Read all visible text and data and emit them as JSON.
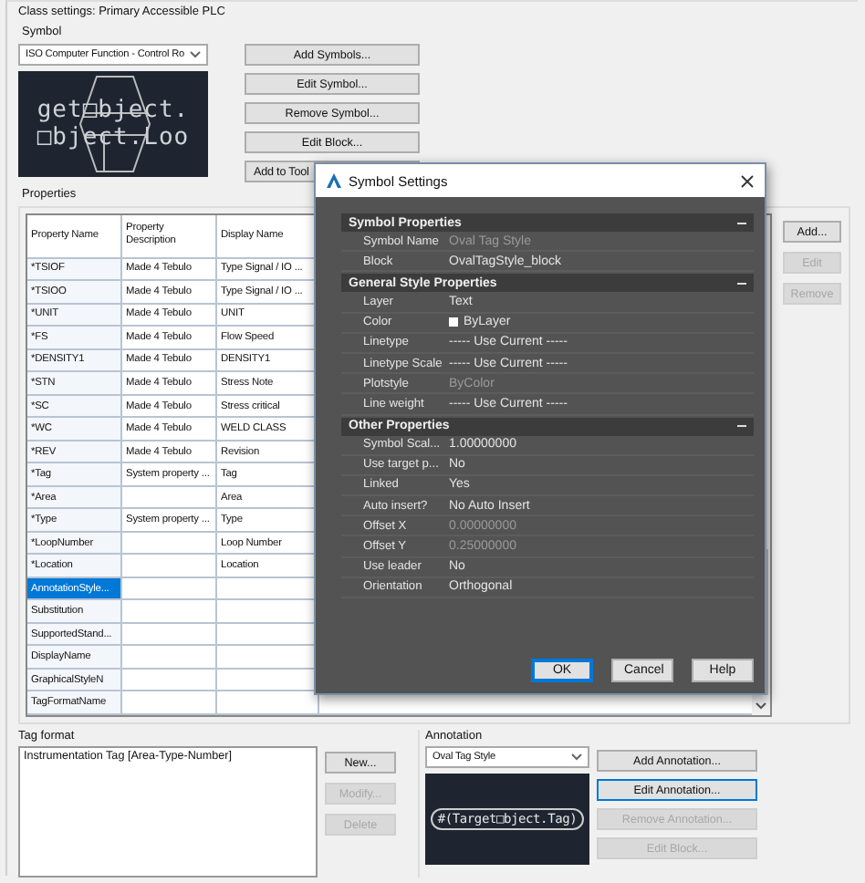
{
  "class_settings": {
    "title": "Class settings: Primary Accessible PLC"
  },
  "symbol": {
    "label": "Symbol",
    "dropdown": "ISO Computer Function - Control Ro",
    "preview_lines": [
      "get□bject.",
      "□bject.Loo"
    ],
    "buttons": [
      {
        "label": "Add Symbols...",
        "disabled": false
      },
      {
        "label": "Edit Symbol...",
        "disabled": false
      },
      {
        "label": "Remove Symbol...",
        "disabled": false
      },
      {
        "label": "Edit Block...",
        "disabled": false
      },
      {
        "label": "Add to Tool",
        "disabled": false
      }
    ]
  },
  "properties": {
    "label": "Properties",
    "columns": [
      "Property Name",
      "Property Description",
      "Display Name"
    ],
    "rows": [
      {
        "name": "*TSIOF",
        "description": "Made 4 Tebulo",
        "display": "Type Signal / IO ...",
        "selected": false
      },
      {
        "name": "*TSIOO",
        "description": "Made 4 Tebulo",
        "display": "Type Signal / IO ...",
        "selected": false
      },
      {
        "name": "*UNIT",
        "description": "Made 4 Tebulo",
        "display": "UNIT",
        "selected": false
      },
      {
        "name": "*FS",
        "description": "Made 4 Tebulo",
        "display": "Flow Speed",
        "selected": false
      },
      {
        "name": "*DENSITY1",
        "description": "Made 4 Tebulo",
        "display": "DENSITY1",
        "selected": false
      },
      {
        "name": "*STN",
        "description": "Made 4 Tebulo",
        "display": "Stress Note",
        "selected": false
      },
      {
        "name": "*SC",
        "description": "Made 4 Tebulo",
        "display": "Stress critical",
        "selected": false
      },
      {
        "name": "*WC",
        "description": "Made 4 Tebulo",
        "display": "WELD CLASS",
        "selected": false
      },
      {
        "name": "*REV",
        "description": "Made 4 Tebulo",
        "display": "Revision",
        "selected": false
      },
      {
        "name": "*Tag",
        "description": "System property ...",
        "display": "Tag",
        "selected": false
      },
      {
        "name": "*Area",
        "description": "",
        "display": "Area",
        "selected": false
      },
      {
        "name": "*Type",
        "description": "System property ...",
        "display": "Type",
        "selected": false
      },
      {
        "name": "*LoopNumber",
        "description": "",
        "display": "Loop Number",
        "selected": false
      },
      {
        "name": "*Location",
        "description": "",
        "display": "Location",
        "selected": false
      },
      {
        "name": "AnnotationStyle...",
        "description": "",
        "display": "",
        "selected": true
      },
      {
        "name": "Substitution",
        "description": "",
        "display": "",
        "selected": false
      },
      {
        "name": "SupportedStand...",
        "description": "",
        "display": "",
        "selected": false
      },
      {
        "name": "DisplayName",
        "description": "",
        "display": "",
        "selected": false
      },
      {
        "name": "GraphicalStyleN",
        "description": "",
        "display": "",
        "selected": false
      },
      {
        "name": "TagFormatName",
        "description": "",
        "display": "",
        "selected": false
      }
    ],
    "buttons": [
      {
        "label": "Add...",
        "disabled": false
      },
      {
        "label": "Edit",
        "disabled": true
      },
      {
        "label": "Remove",
        "disabled": true
      }
    ]
  },
  "tag_format": {
    "label": "Tag format",
    "value": "Instrumentation Tag [Area-Type-Number]",
    "buttons": [
      {
        "label": "New...",
        "disabled": false
      },
      {
        "label": "Modify...",
        "disabled": true
      },
      {
        "label": "Delete",
        "disabled": true
      }
    ]
  },
  "annotation": {
    "label": "Annotation",
    "dropdown": "Oval Tag Style",
    "preview_text": "#(Target□bject.Tag)",
    "buttons": [
      {
        "label": "Add Annotation...",
        "disabled": false,
        "focused": false
      },
      {
        "label": "Edit Annotation...",
        "disabled": false,
        "focused": true
      },
      {
        "label": "Remove Annotation...",
        "disabled": true,
        "focused": false
      },
      {
        "label": "Edit Block...",
        "disabled": true,
        "focused": false
      }
    ]
  },
  "dialog": {
    "title": "Symbol Settings",
    "sections": [
      {
        "title": "Symbol Properties",
        "expanded": true,
        "rows": [
          {
            "kind": "text",
            "label": "Symbol Name",
            "value": "Oval Tag Style",
            "disabled": true
          },
          {
            "kind": "text",
            "label": "Block",
            "value": "OvalTagStyle_block",
            "disabled": false
          }
        ]
      },
      {
        "title": "General Style Properties",
        "expanded": true,
        "rows": [
          {
            "kind": "text",
            "label": "Layer",
            "value": "Text",
            "disabled": false
          },
          {
            "kind": "color",
            "label": "Color",
            "value": "ByLayer",
            "disabled": false,
            "color": "#ffffff"
          },
          {
            "kind": "text",
            "label": "Linetype",
            "value": "----- Use Current -----",
            "disabled": false
          },
          {
            "kind": "text",
            "label": "Linetype Scale",
            "value": "----- Use Current -----",
            "disabled": false
          },
          {
            "kind": "text",
            "label": "Plotstyle",
            "value": "ByColor",
            "disabled": true
          },
          {
            "kind": "text",
            "label": "Line weight",
            "value": "----- Use Current -----",
            "disabled": false
          }
        ]
      },
      {
        "title": "Other Properties",
        "expanded": true,
        "rows": [
          {
            "kind": "text",
            "label": "Symbol Scal...",
            "value": "1.00000000",
            "disabled": false
          },
          {
            "kind": "text",
            "label": "Use target p...",
            "value": "No",
            "disabled": false
          },
          {
            "kind": "text",
            "label": "Linked",
            "value": "Yes",
            "disabled": false
          },
          {
            "kind": "text",
            "label": "Auto insert?",
            "value": "No Auto Insert",
            "disabled": false
          },
          {
            "kind": "text",
            "label": "Offset X",
            "value": "0.00000000",
            "disabled": true
          },
          {
            "kind": "text",
            "label": "Offset Y",
            "value": "0.25000000",
            "disabled": true
          },
          {
            "kind": "text",
            "label": "Use leader",
            "value": "No",
            "disabled": false
          },
          {
            "kind": "text",
            "label": "Orientation",
            "value": "Orthogonal",
            "disabled": false
          }
        ]
      }
    ],
    "buttons": [
      {
        "label": "OK",
        "focused": true
      },
      {
        "label": "Cancel",
        "focused": false
      },
      {
        "label": "Help",
        "focused": false
      }
    ]
  }
}
